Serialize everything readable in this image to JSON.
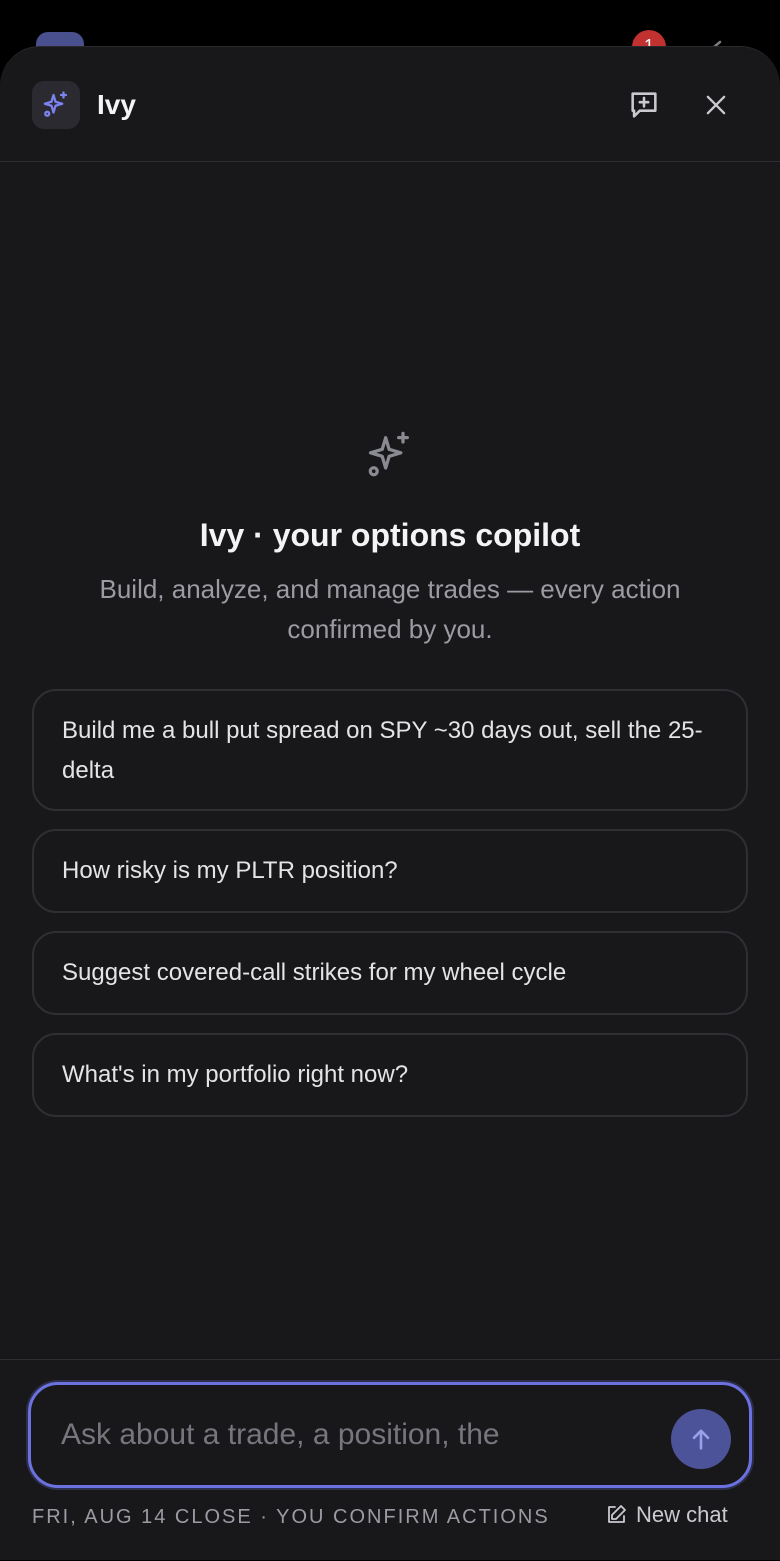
{
  "background": {
    "notification_count": "1"
  },
  "header": {
    "title": "Ivy"
  },
  "hero": {
    "title": "Ivy · your options copilot",
    "subtitle": "Build, analyze, and manage trades — every action confirmed by you."
  },
  "suggestions": [
    {
      "label": "Build me a bull put spread on SPY ~30 days out, sell the 25-delta"
    },
    {
      "label": "How risky is my PLTR position?"
    },
    {
      "label": "Suggest covered-call strikes for my wheel cycle"
    },
    {
      "label": "What's in my portfolio right now?"
    }
  ],
  "composer": {
    "placeholder": "Ask about a trade, a position, the",
    "status": "FRI, AUG 14 CLOSE · YOU CONFIRM ACTIONS",
    "new_chat_label": "New chat"
  },
  "colors": {
    "accent": "#6b72e0",
    "sheet_bg": "#18181b",
    "send_button": "#4d5399",
    "badge": "#c0312f"
  },
  "icons": [
    "sparkles-icon",
    "new-chat-icon",
    "close-icon",
    "arrow-up-icon",
    "edit-icon"
  ]
}
